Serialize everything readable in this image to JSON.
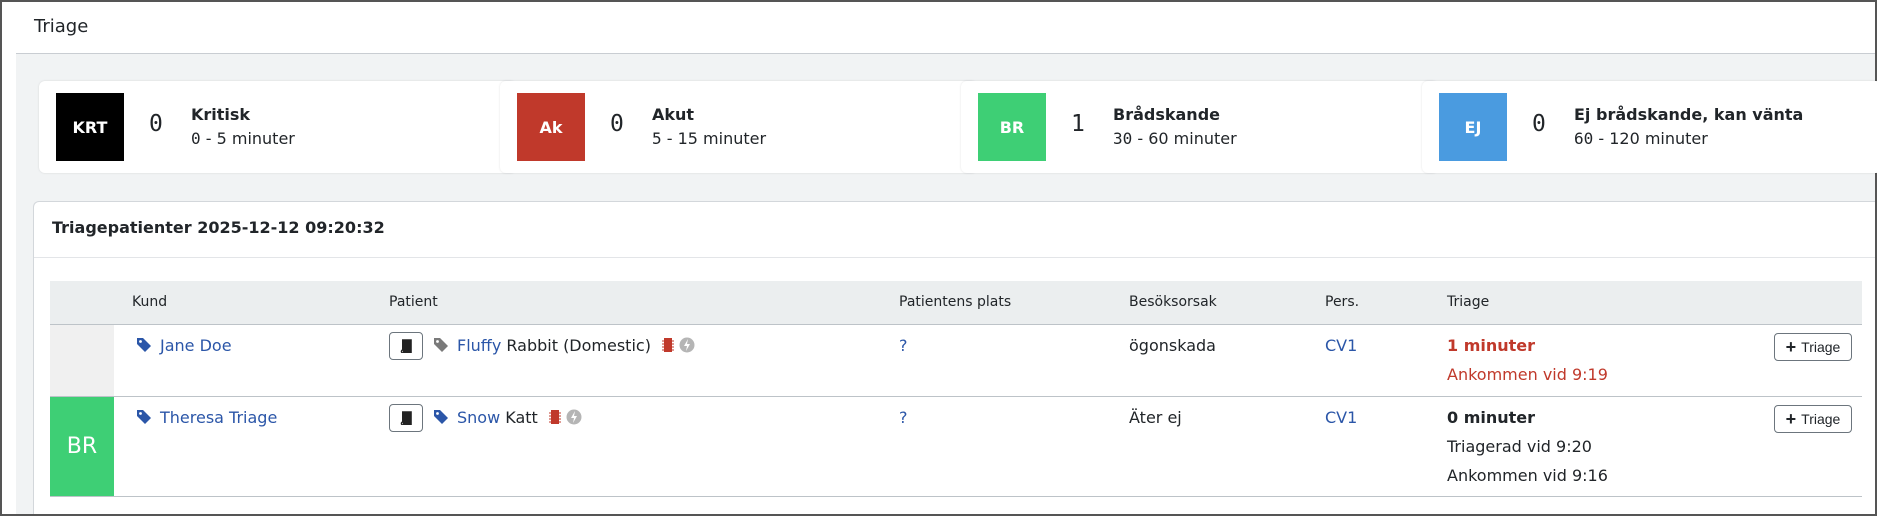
{
  "page": {
    "title": "Triage"
  },
  "summary_cards": [
    {
      "code": "KRT",
      "color": "#000000",
      "count": "0",
      "name": "Kritisk",
      "range_from": "0",
      "range_rest": " - 5 minuter"
    },
    {
      "code": "Ak",
      "color": "#c0392b",
      "count": "0",
      "name": "Akut",
      "range_from": "5",
      "range_rest": " - 15 minuter"
    },
    {
      "code": "BR",
      "color": "#3ecf75",
      "count": "1",
      "name": "Brådskande",
      "range_from": "30",
      "range_rest": " - 60 minuter"
    },
    {
      "code": "EJ",
      "color": "#4a9be0",
      "count": "0",
      "name": "Ej brådskande, kan vänta",
      "range_from": "60",
      "range_rest": " - 120 minuter"
    }
  ],
  "panel": {
    "title": "Triagepatienter 2025-12-12 09:20:32"
  },
  "table": {
    "headers": {
      "kund": "Kund",
      "patient": "Patient",
      "plats": "Patientens plats",
      "orsak": "Besöksorsak",
      "pers": "Pers.",
      "triage": "Triage"
    },
    "rows": [
      {
        "priority": "",
        "priority_color": "#f0f0f0",
        "customer": "Jane Doe",
        "patient_name": "Fluffy",
        "species": "Rabbit (Domestic)",
        "location": "?",
        "reason": "ögonskada",
        "staff": "CV1",
        "triage_time": "1 minuter",
        "arrived": "Ankommen vid 9:19",
        "triage_button": "Triage"
      },
      {
        "priority": "BR",
        "priority_color": "#3ecf75",
        "customer": "Theresa Triage",
        "patient_name": "Snow",
        "species": "Katt",
        "location": "?",
        "reason": "Äter ej",
        "staff": "CV1",
        "triage_time": "0 minuter",
        "triaged": "Triagerad vid 9:20",
        "arrived": "Ankommen vid 9:16",
        "triage_button": "Triage"
      }
    ]
  },
  "icons": {
    "tag": "tag-icon",
    "journal": "book-icon",
    "chip": "microchip-icon",
    "insurance": "bolt-badge-icon"
  },
  "colors": {
    "link": "#2b56a8",
    "red": "#c0392b"
  }
}
